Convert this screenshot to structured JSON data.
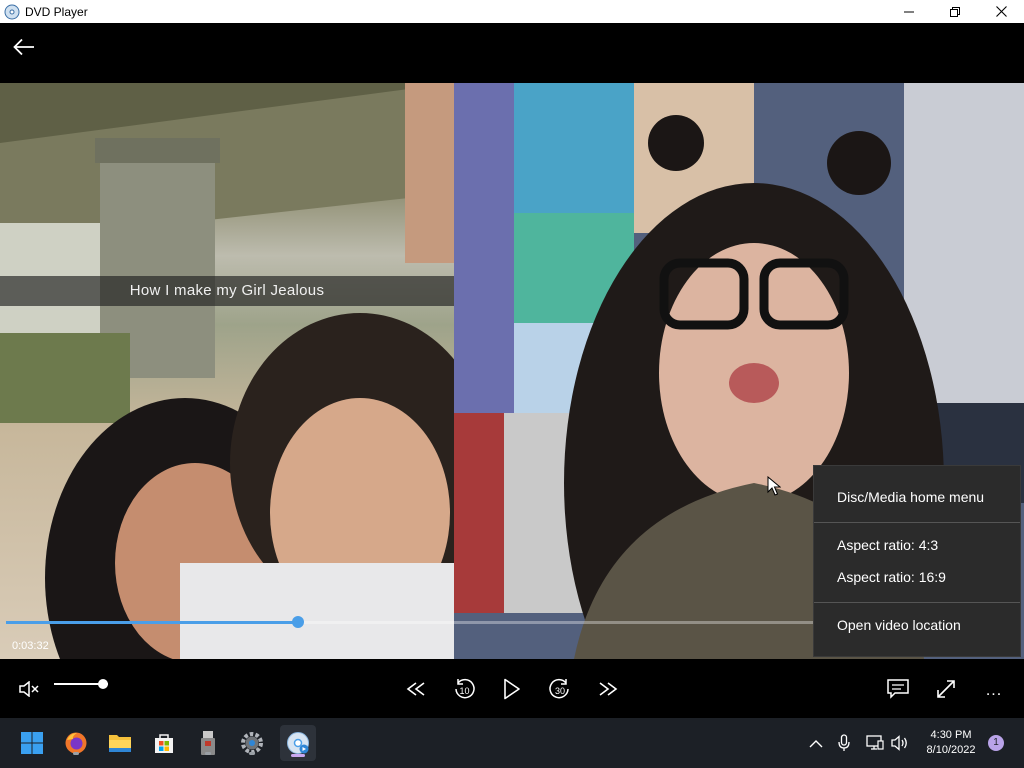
{
  "window": {
    "title": "DVD Player",
    "app_icon": "disc-icon",
    "controls": [
      "minimize-icon",
      "restore-icon",
      "close-icon"
    ]
  },
  "topbar": {
    "back_icon": "back-arrow-icon"
  },
  "video": {
    "caption": "How I make my Girl Jealous",
    "elapsed": "0:03:32",
    "progress_fraction": 0.289,
    "accent": "#4a9ee8"
  },
  "controls": {
    "volume_fraction": 0.9,
    "icons": [
      "mute-icon",
      "skip-back-icon",
      "rewind-10-icon",
      "play-icon",
      "forward-30-icon",
      "skip-forward-icon",
      "subtitles-icon",
      "fullscreen-icon",
      "more-icon"
    ],
    "rewind_seconds": "10",
    "forward_seconds": "30",
    "more_label": "..."
  },
  "menu": {
    "items": [
      "Disc/Media home menu",
      "Aspect ratio: 4:3",
      "Aspect ratio: 16:9",
      "Open video location"
    ]
  },
  "taskbar": {
    "apps": [
      "windows-start-icon",
      "firefox-icon",
      "file-explorer-icon",
      "microsoft-store-icon",
      "usb-drive-icon",
      "settings-icon",
      "dvd-player-icon"
    ],
    "tray": [
      "chevron-up-icon",
      "microphone-icon",
      "network-icon",
      "speaker-icon"
    ],
    "time": "4:30 PM",
    "date": "8/10/2022",
    "notification_count": "1"
  }
}
